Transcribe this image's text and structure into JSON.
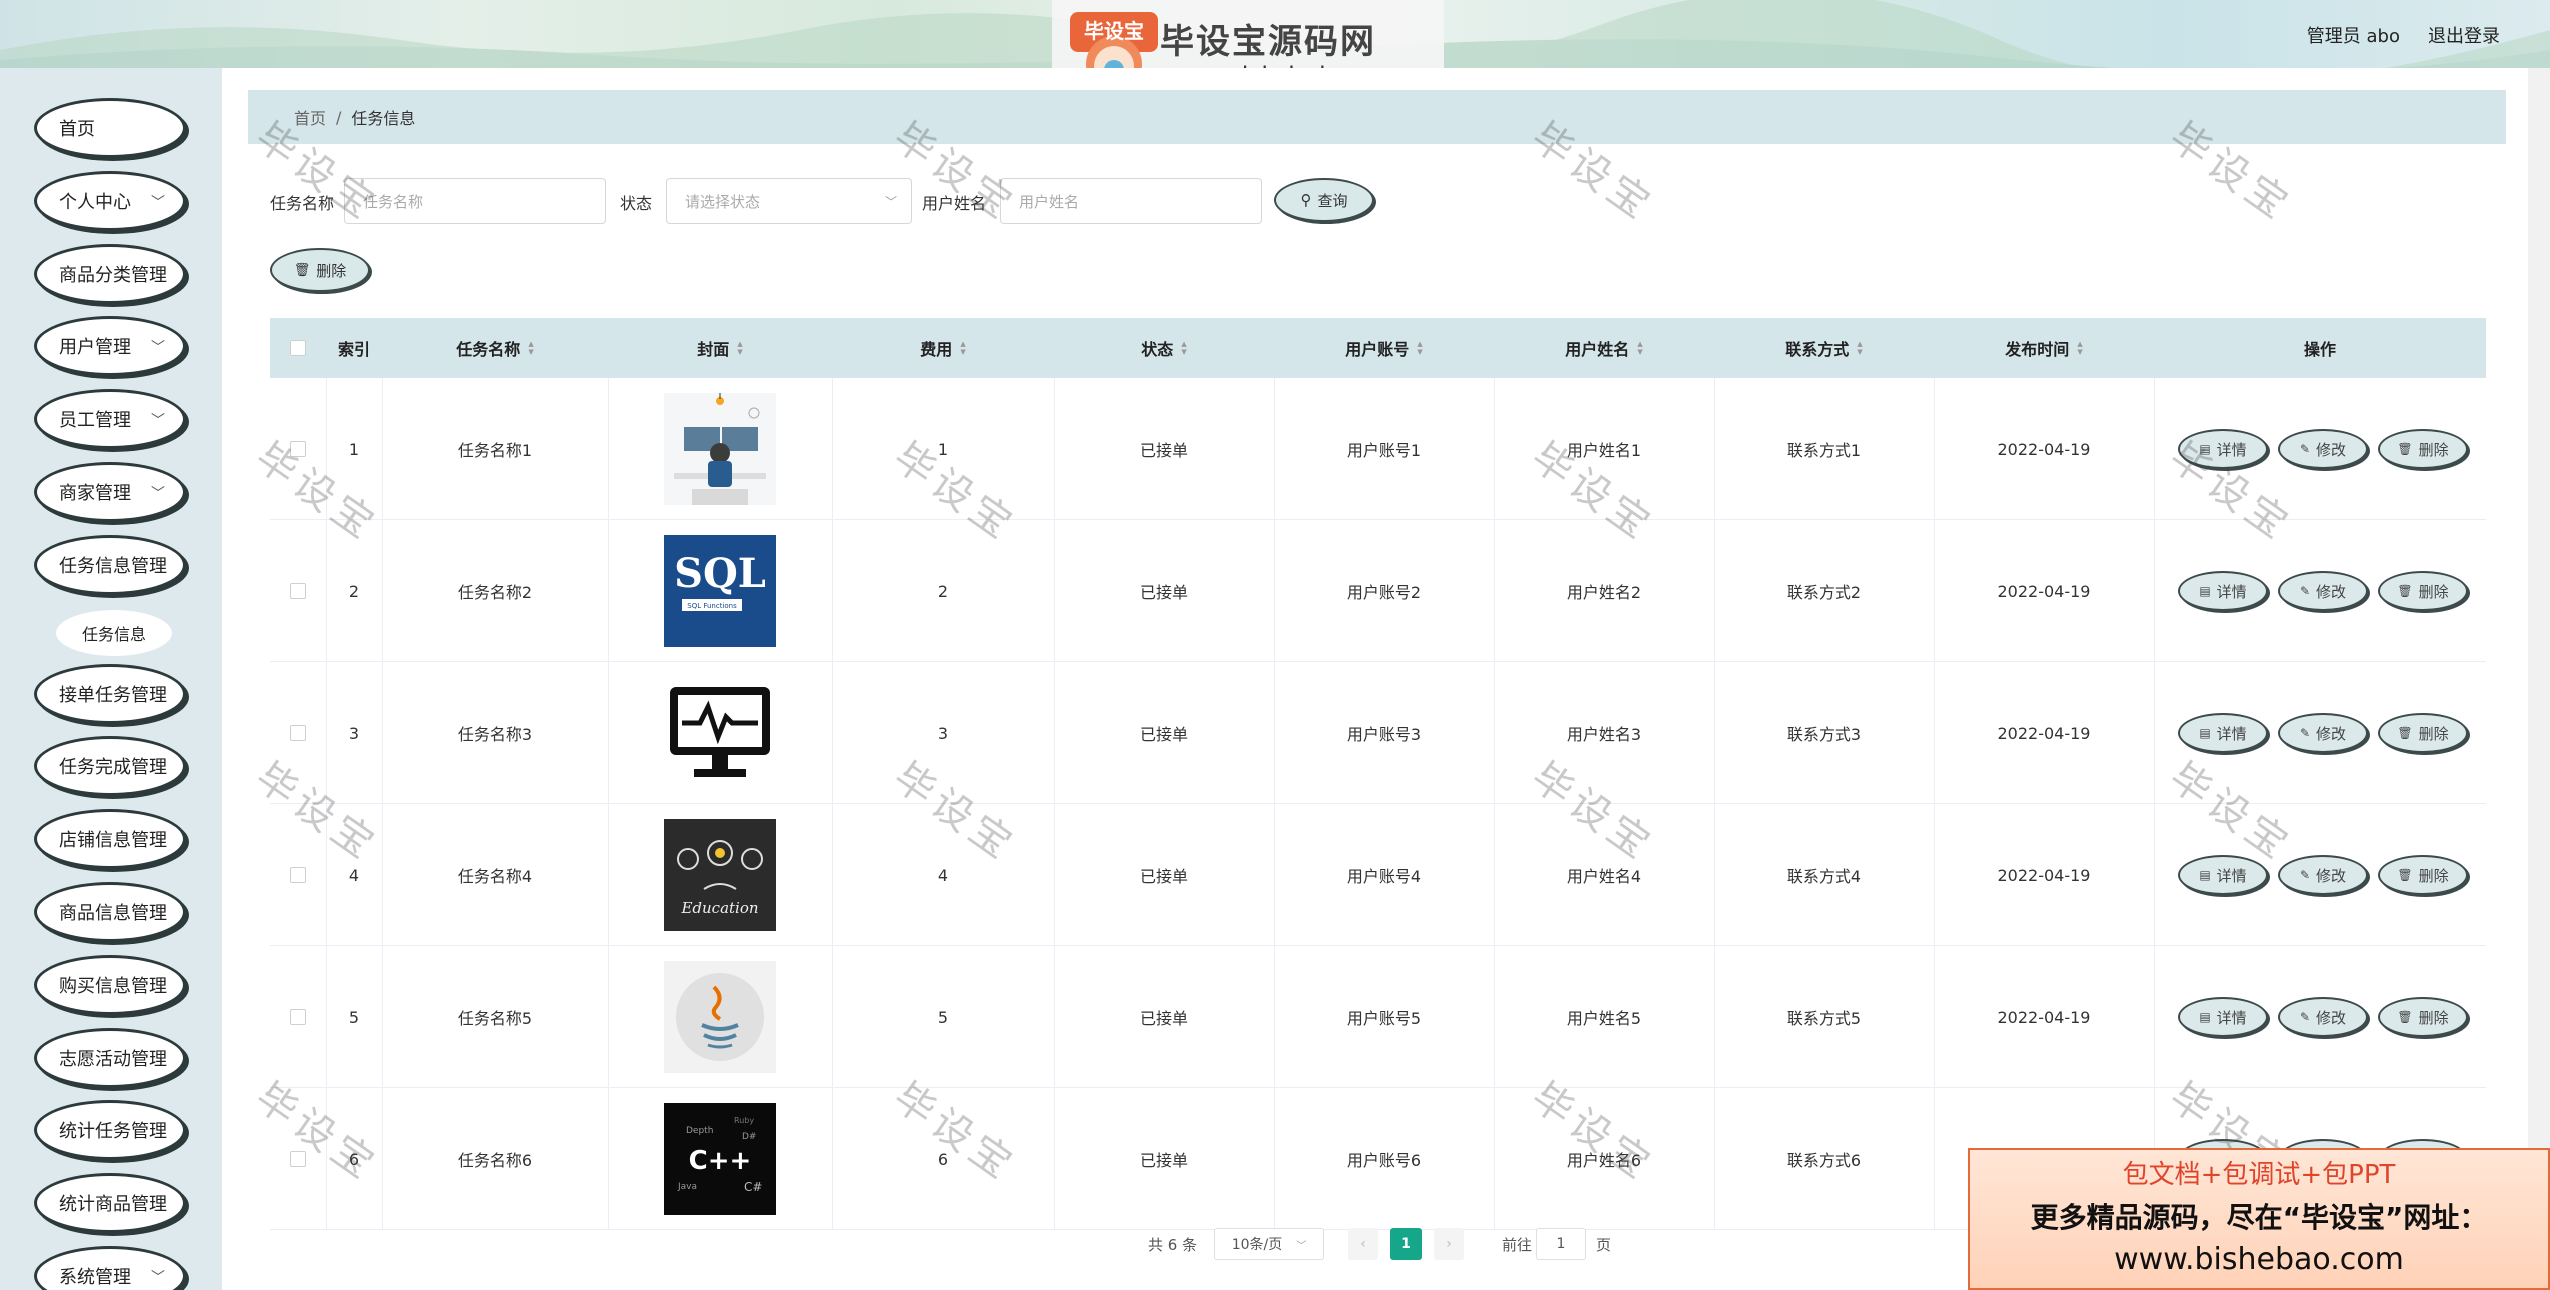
{
  "header": {
    "logo_title": "毕设宝源码网",
    "logo_url": "www.bishebao.com",
    "user_label": "管理员 abo",
    "logout_label": "退出登录"
  },
  "sidebar": {
    "items": [
      {
        "label": "首页",
        "has_arrow": false
      },
      {
        "label": "个人中心",
        "has_arrow": true
      },
      {
        "label": "商品分类管理",
        "has_arrow": false
      },
      {
        "label": "用户管理",
        "has_arrow": true
      },
      {
        "label": "员工管理",
        "has_arrow": true
      },
      {
        "label": "商家管理",
        "has_arrow": true
      },
      {
        "label": "任务信息管理",
        "has_arrow": false
      },
      {
        "label": "任务信息",
        "sub": true
      },
      {
        "label": "接单任务管理",
        "has_arrow": false
      },
      {
        "label": "任务完成管理",
        "has_arrow": false
      },
      {
        "label": "店铺信息管理",
        "has_arrow": false
      },
      {
        "label": "商品信息管理",
        "has_arrow": false
      },
      {
        "label": "购买信息管理",
        "has_arrow": false
      },
      {
        "label": "志愿活动管理",
        "has_arrow": false
      },
      {
        "label": "统计任务管理",
        "has_arrow": false
      },
      {
        "label": "统计商品管理",
        "has_arrow": false
      },
      {
        "label": "系统管理",
        "has_arrow": true
      }
    ]
  },
  "breadcrumb": {
    "home": "首页",
    "separator": "/",
    "current": "任务信息"
  },
  "filters": {
    "task_name_label": "任务名称",
    "task_name_placeholder": "任务名称",
    "status_label": "状态",
    "status_placeholder": "请选择状态",
    "user_name_label": "用户姓名",
    "user_name_placeholder": "用户姓名",
    "search_label": "查询",
    "delete_label": "删除"
  },
  "table": {
    "columns": [
      "索引",
      "任务名称",
      "封面",
      "费用",
      "状态",
      "用户账号",
      "用户姓名",
      "联系方式",
      "发布时间",
      "操作"
    ],
    "rows": [
      {
        "index": "1",
        "name": "任务名称1",
        "cover": "programmer",
        "fee": "1",
        "status": "已接单",
        "account": "用户账号1",
        "username": "用户姓名1",
        "contact": "联系方式1",
        "time": "2022-04-19"
      },
      {
        "index": "2",
        "name": "任务名称2",
        "cover": "sql",
        "fee": "2",
        "status": "已接单",
        "account": "用户账号2",
        "username": "用户姓名2",
        "contact": "联系方式2",
        "time": "2022-04-19"
      },
      {
        "index": "3",
        "name": "任务名称3",
        "cover": "monitor",
        "fee": "3",
        "status": "已接单",
        "account": "用户账号3",
        "username": "用户姓名3",
        "contact": "联系方式3",
        "time": "2022-04-19"
      },
      {
        "index": "4",
        "name": "任务名称4",
        "cover": "education",
        "fee": "4",
        "status": "已接单",
        "account": "用户账号4",
        "username": "用户姓名4",
        "contact": "联系方式4",
        "time": "2022-04-19"
      },
      {
        "index": "5",
        "name": "任务名称5",
        "cover": "java",
        "fee": "5",
        "status": "已接单",
        "account": "用户账号5",
        "username": "用户姓名5",
        "contact": "联系方式5",
        "time": "2022-04-19"
      },
      {
        "index": "6",
        "name": "任务名称6",
        "cover": "cpp",
        "fee": "6",
        "status": "已接单",
        "account": "用户账号6",
        "username": "用户姓名6",
        "contact": "联系方式6",
        "time": ""
      }
    ],
    "ops": {
      "detail": "详情",
      "edit": "修改",
      "delete": "删除"
    },
    "cover_texts": {
      "sql_title": "SQL",
      "sql_sub": "SQL Functions",
      "education": "Education"
    }
  },
  "pagination": {
    "total": "共 6 条",
    "page_size": "10条/页",
    "current_page": "1",
    "goto_prefix": "前往",
    "goto_value": "1",
    "goto_suffix": "页"
  },
  "watermark": "毕设宝",
  "ad": {
    "line1": "包文档+包调试+包PPT",
    "line2": "更多精品源码，尽在“毕设宝”网址：",
    "line3": "www.bishebao.com"
  },
  "colors": {
    "accent": "#16a78a",
    "header_row": "#d5e6ea",
    "sidebar_bg": "#dde9ec",
    "ad_red": "#e0442a"
  }
}
